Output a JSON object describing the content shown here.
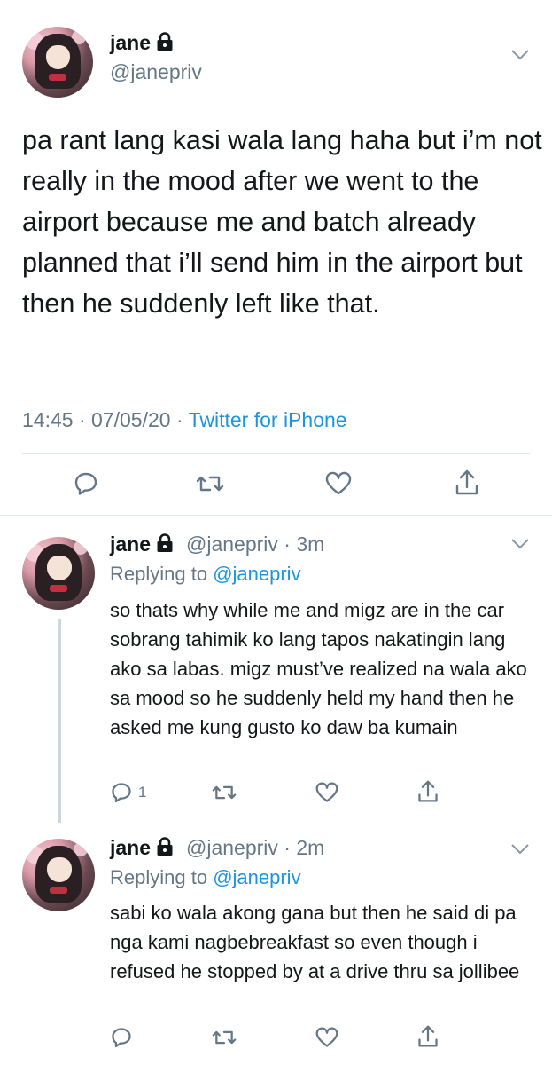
{
  "main_tweet": {
    "name": "jane",
    "handle": "@janepriv",
    "text": "pa rant lang kasi wala lang haha but i’m not really in the mood after we went to the airport because me and batch already planned that i’ll send him in the airport but then he suddenly left like that.",
    "time": "14:45",
    "date": "07/05/20",
    "separator": "·",
    "source": "Twitter for iPhone"
  },
  "replies": [
    {
      "name": "jane",
      "handle_time": "@janepriv · 3m",
      "replying_prefix": "Replying to ",
      "replying_to": "@janepriv",
      "text": "so thats why while me and migz are in the car sobrang tahimik ko lang tapos nakatingin lang ako sa labas. migz must’ve realized na wala ako sa mood so he suddenly held my hand then he asked me kung gusto ko daw ba kumain",
      "reply_count": "1"
    },
    {
      "name": "jane",
      "handle_time": "@janepriv · 2m",
      "replying_prefix": "Replying to ",
      "replying_to": "@janepriv",
      "text": "sabi ko wala akong gana but then he said di pa nga kami nagbebreakfast so even though i refused he stopped by at a drive thru sa jollibee",
      "reply_count": ""
    }
  ],
  "icons": {
    "reply": "reply-icon",
    "retweet": "retweet-icon",
    "like": "heart-icon",
    "share": "share-icon",
    "lock": "lock-icon",
    "more": "chevron-down-icon"
  },
  "colors": {
    "text": "#14171a",
    "secondary": "#657786",
    "link": "#1b95e0",
    "divider": "#e1e8ed"
  }
}
